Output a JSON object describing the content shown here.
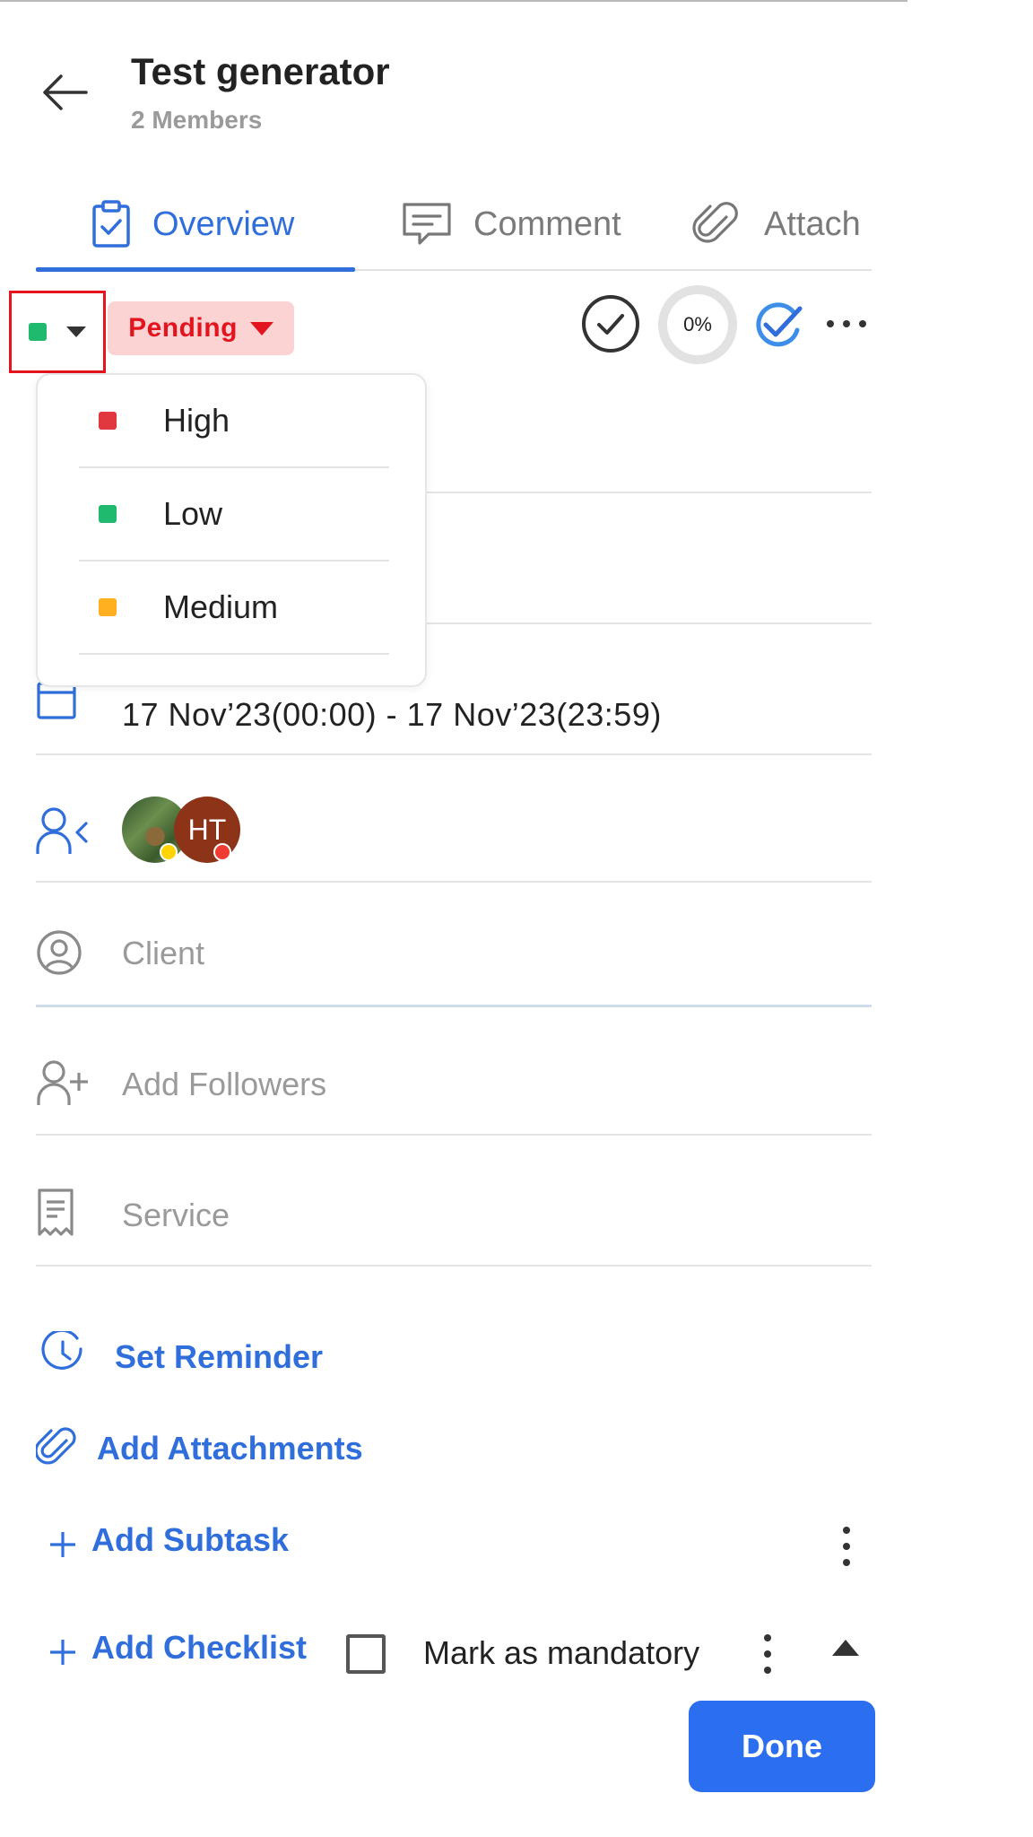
{
  "header": {
    "title": "Test generator",
    "subtitle": "2 Members"
  },
  "tabs": [
    {
      "label": "Overview",
      "icon": "clipboard-check-icon",
      "active": true
    },
    {
      "label": "Comment",
      "icon": "comment-icon",
      "active": false
    },
    {
      "label": "Attach",
      "icon": "paperclip-icon",
      "active": false
    }
  ],
  "toolbar": {
    "priority_color": "#1fba6e",
    "status": "Pending",
    "progress_percent": "0%"
  },
  "priority_dropdown": {
    "options": [
      {
        "label": "High",
        "color": "#e0383e"
      },
      {
        "label": "Low",
        "color": "#1fba6e"
      },
      {
        "label": "Medium",
        "color": "#ffb020"
      }
    ]
  },
  "fields": {
    "date_range": "17 Nov’23(00:00) - 17 Nov’23(23:59)",
    "assignee_initials": "HT",
    "client_placeholder": "Client",
    "followers_placeholder": "Add Followers",
    "service_placeholder": "Service"
  },
  "actions": {
    "set_reminder": "Set Reminder",
    "add_attachments": "Add Attachments",
    "add_subtask": "Add Subtask",
    "add_checklist": "Add Checklist",
    "mark_mandatory": "Mark as mandatory",
    "done": "Done"
  },
  "colors": {
    "accent": "#2f6edb",
    "status_red": "#e3141e",
    "status_bg": "#fbd3d3"
  }
}
